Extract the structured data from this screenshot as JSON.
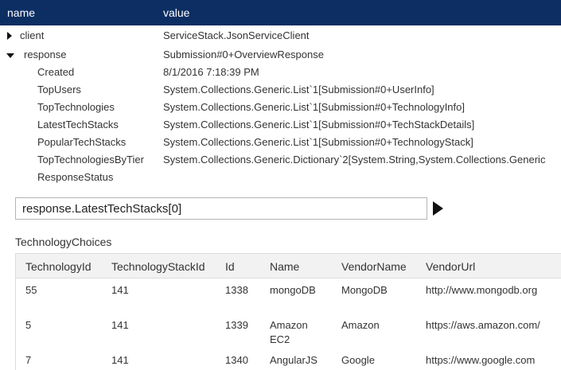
{
  "header": {
    "name_label": "name",
    "value_label": "value"
  },
  "tree": {
    "client": {
      "name": "client",
      "value": "ServiceStack.JsonServiceClient"
    },
    "response": {
      "name": "response",
      "value": "Submission#0+OverviewResponse"
    },
    "children": [
      {
        "name": "Created",
        "value": "8/1/2016 7:18:39 PM"
      },
      {
        "name": "TopUsers",
        "value": "System.Collections.Generic.List`1[Submission#0+UserInfo]"
      },
      {
        "name": "TopTechnologies",
        "value": "System.Collections.Generic.List`1[Submission#0+TechnologyInfo]"
      },
      {
        "name": "LatestTechStacks",
        "value": "System.Collections.Generic.List`1[Submission#0+TechStackDetails]"
      },
      {
        "name": "PopularTechStacks",
        "value": "System.Collections.Generic.List`1[Submission#0+TechnologyStack]"
      },
      {
        "name": "TopTechnologiesByTier",
        "value": "System.Collections.Generic.Dictionary`2[System.String,System.Collections.Generic"
      },
      {
        "name": "ResponseStatus",
        "value": ""
      }
    ]
  },
  "query": {
    "value": "response.LatestTechStacks[0]"
  },
  "section_title": "TechnologyChoices",
  "table": {
    "columns": [
      "TechnologyId",
      "TechnologyStackId",
      "Id",
      "Name",
      "VendorName",
      "VendorUrl"
    ],
    "rows": [
      [
        "55",
        "141",
        "1338",
        "mongoDB",
        "MongoDB",
        "http://www.mongodb.org"
      ],
      [
        "5",
        "141",
        "1339",
        "Amazon EC2",
        "Amazon",
        "https://aws.amazon.com/"
      ],
      [
        "7",
        "141",
        "1340",
        "AngularJS",
        "Google",
        "https://www.google.com"
      ]
    ]
  }
}
